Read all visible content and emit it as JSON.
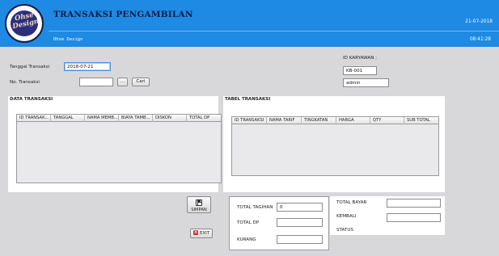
{
  "header": {
    "logo_text": [
      "Ohse",
      "Design"
    ],
    "title": "TRANSAKSI PENGAMBILAN",
    "subtitle": "Ohse Design",
    "date": "21-07-2018",
    "time": "08:41:28"
  },
  "form": {
    "tanggal_label": "Tanggal Transaksi",
    "tanggal_value": "2018-07-21",
    "no_transaksi_label": "No. Transaksi",
    "no_transaksi_value": "",
    "browse_label": "...",
    "cari_label": "Cari",
    "id_karyawan_label": "ID KARYAWAN :",
    "id_karyawan_value": "KB-001",
    "user_value": "admin"
  },
  "data_transaksi": {
    "title": "DATA TRANSAKSI",
    "columns": [
      "ID TRANSAK...",
      "TANGGAL",
      "NAMA MEMB...",
      "BIAYA TAMB...",
      "DISKON",
      "TOTAL DP"
    ]
  },
  "tabel_transaksi": {
    "title": "TABEL TRANSAKSI",
    "columns": [
      "ID TRANSAKSI",
      "NAMA TARIF",
      "TINGKATAN",
      "HARGA",
      "QTY",
      "SUB TOTAL"
    ]
  },
  "actions": {
    "simpan_label": "SIMPAN",
    "exit_label": "EXIT"
  },
  "totals": {
    "total_tagihan_label": "TOTAL TAGIHAN",
    "total_tagihan_value": "0",
    "total_dp_label": "TOTAL DP",
    "total_dp_value": "",
    "kurang_label": "KURANG",
    "kurang_value": ""
  },
  "payment": {
    "total_bayar_label": "TOTAL BAYAR",
    "total_bayar_value": "",
    "kembali_label": "KEMBALI",
    "kembali_value": "",
    "status_label": "STATUS"
  },
  "colors": {
    "header_bg": "#1e8ae3",
    "window_bg": "#d8d8da",
    "exit_icon": "#e02a2a"
  }
}
